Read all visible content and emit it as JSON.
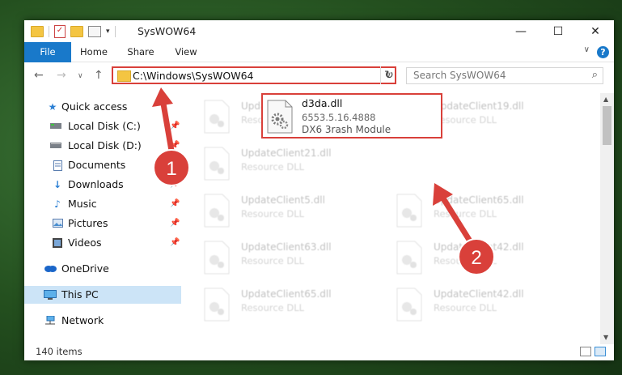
{
  "window": {
    "title": "SysWOW64",
    "controls": {
      "minimize": "—",
      "maximize": "☐",
      "close": "✕"
    }
  },
  "ribbon": {
    "tabs": [
      "File",
      "Home",
      "Share",
      "View"
    ],
    "help": "?"
  },
  "nav": {
    "address": "C:\\Windows\\SysWOW64",
    "search_placeholder": "Search SysWOW64"
  },
  "sidebar": {
    "items": [
      {
        "label": "Quick access",
        "icon": "star-icon"
      },
      {
        "label": "Local Disk (C:)",
        "icon": "drive-icon"
      },
      {
        "label": "Local Disk (D:)",
        "icon": "drive-icon"
      },
      {
        "label": "Documents",
        "icon": "documents-icon"
      },
      {
        "label": "Downloads",
        "icon": "download-icon"
      },
      {
        "label": "Music",
        "icon": "music-icon"
      },
      {
        "label": "Pictures",
        "icon": "pictures-icon"
      },
      {
        "label": "Videos",
        "icon": "videos-icon"
      },
      {
        "label": "OneDrive",
        "icon": "cloud-icon"
      },
      {
        "label": "This PC",
        "icon": "computer-icon"
      },
      {
        "label": "Network",
        "icon": "network-icon"
      }
    ]
  },
  "files": [
    {
      "name": "UpdateClient63.dll",
      "desc": "Resource DLL"
    },
    {
      "name": "UpdateClient19.dll",
      "desc": "Resource DLL"
    },
    {
      "name": "UpdateClient21.dll",
      "desc": "Resource DLL"
    },
    {
      "name": "UpdateClient5.dll",
      "desc": "Resource DLL"
    },
    {
      "name": "UpdateClient65.dll",
      "desc": "Resource DLL"
    },
    {
      "name": "UpdateClient63.dll",
      "desc": "Resource DLL"
    },
    {
      "name": "UpdateClient42.dll",
      "desc": "Resource DLL"
    },
    {
      "name": "UpdateClient65.dll",
      "desc": "Resource DLL"
    },
    {
      "name": "UpdateClient42.dll",
      "desc": "Resource DLL"
    }
  ],
  "highlighted_file": {
    "name": "d3da.dll",
    "version": "6553.5.16.4888",
    "description": "DX6 3rash Module"
  },
  "status": {
    "count": "140 items"
  },
  "annotations": {
    "step1": "1",
    "step2": "2",
    "color": "#d9403a"
  }
}
